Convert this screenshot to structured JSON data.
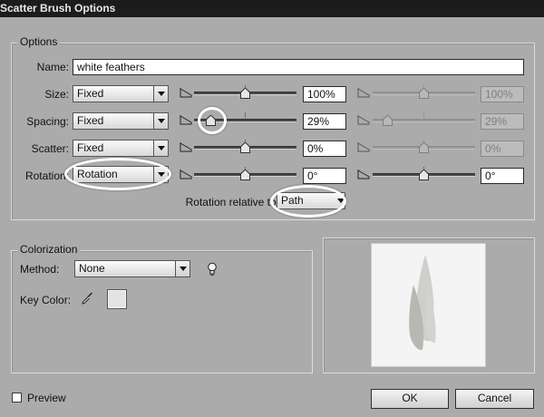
{
  "window": {
    "title": "Scatter Brush Options"
  },
  "options": {
    "legend": "Options",
    "name_label": "Name:",
    "name_value": "white feathers",
    "rows": [
      {
        "label": "Size:",
        "mode": "Fixed",
        "min": "100%",
        "max": "100%",
        "max_enabled": false,
        "min_level": 0.5,
        "max_level": 0.5
      },
      {
        "label": "Spacing:",
        "mode": "Fixed",
        "min": "29%",
        "max": "29%",
        "max_enabled": false,
        "min_level": 0.15,
        "max_level": 0.15
      },
      {
        "label": "Scatter:",
        "mode": "Fixed",
        "min": "0%",
        "max": "0%",
        "max_enabled": false,
        "min_level": 0.5,
        "max_level": 0.5
      },
      {
        "label": "Rotation:",
        "mode": "Rotation",
        "min": "0°",
        "max": "0°",
        "max_enabled": true,
        "min_level": 0.5,
        "max_level": 0.5
      }
    ],
    "rotation_relative_label": "Rotation relative to:",
    "rotation_relative_value": "Path"
  },
  "colorization": {
    "legend": "Colorization",
    "method_label": "Method:",
    "method_value": "None",
    "tips_icon": "lightbulb-icon",
    "key_color_label": "Key Color:",
    "eyedropper_icon": "eyedropper-icon",
    "key_color": "#e3e3e3"
  },
  "preview": {
    "label": "Preview",
    "checked": false
  },
  "buttons": {
    "ok": "OK",
    "cancel": "Cancel"
  },
  "colors": {
    "feather_light": "#cfcfcb",
    "feather_dark": "#b7b8b1",
    "highlight": "#ffffff"
  }
}
